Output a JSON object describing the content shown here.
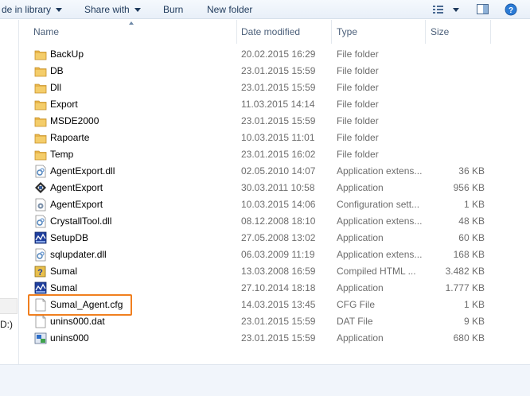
{
  "toolbar": {
    "include_in_library": "de in library",
    "share_with": "Share with",
    "burn": "Burn",
    "new_folder": "New folder"
  },
  "nav": {
    "drive_label": "D:)"
  },
  "columns": {
    "name": "Name",
    "date_modified": "Date modified",
    "type": "Type",
    "size": "Size"
  },
  "files": [
    {
      "name": "BackUp",
      "date": "20.02.2015 16:29",
      "type": "File folder",
      "size": "",
      "icon": "folder-icon"
    },
    {
      "name": "DB",
      "date": "23.01.2015 15:59",
      "type": "File folder",
      "size": "",
      "icon": "folder-icon"
    },
    {
      "name": "Dll",
      "date": "23.01.2015 15:59",
      "type": "File folder",
      "size": "",
      "icon": "folder-icon"
    },
    {
      "name": "Export",
      "date": "11.03.2015 14:14",
      "type": "File folder",
      "size": "",
      "icon": "folder-icon"
    },
    {
      "name": "MSDE2000",
      "date": "23.01.2015 15:59",
      "type": "File folder",
      "size": "",
      "icon": "folder-icon"
    },
    {
      "name": "Rapoarte",
      "date": "10.03.2015 11:01",
      "type": "File folder",
      "size": "",
      "icon": "folder-icon"
    },
    {
      "name": "Temp",
      "date": "23.01.2015 16:02",
      "type": "File folder",
      "size": "",
      "icon": "folder-icon"
    },
    {
      "name": "AgentExport.dll",
      "date": "02.05.2010 14:07",
      "type": "Application extens...",
      "size": "36 KB",
      "icon": "dll-icon"
    },
    {
      "name": "AgentExport",
      "date": "30.03.2011 10:58",
      "type": "Application",
      "size": "956 KB",
      "icon": "application-icon"
    },
    {
      "name": "AgentExport",
      "date": "10.03.2015 14:06",
      "type": "Configuration sett...",
      "size": "1 KB",
      "icon": "config-icon"
    },
    {
      "name": "CrystallTool.dll",
      "date": "08.12.2008 18:10",
      "type": "Application extens...",
      "size": "48 KB",
      "icon": "dll-icon"
    },
    {
      "name": "SetupDB",
      "date": "27.05.2008 13:02",
      "type": "Application",
      "size": "60 KB",
      "icon": "setup-icon"
    },
    {
      "name": "sqlupdater.dll",
      "date": "06.03.2009 11:19",
      "type": "Application extens...",
      "size": "168 KB",
      "icon": "dll-icon"
    },
    {
      "name": "Sumal",
      "date": "13.03.2008 16:59",
      "type": "Compiled HTML ...",
      "size": "3.482 KB",
      "icon": "help-icon"
    },
    {
      "name": "Sumal",
      "date": "27.10.2014 18:18",
      "type": "Application",
      "size": "1.777 KB",
      "icon": "setup-icon"
    },
    {
      "name": "Sumal_Agent.cfg",
      "date": "14.03.2015 13:45",
      "type": "CFG File",
      "size": "1 KB",
      "icon": "file-icon"
    },
    {
      "name": "unins000.dat",
      "date": "23.01.2015 15:59",
      "type": "DAT File",
      "size": "9 KB",
      "icon": "file-icon"
    },
    {
      "name": "unins000",
      "date": "23.01.2015 15:59",
      "type": "Application",
      "size": "680 KB",
      "icon": "uninstaller-icon"
    }
  ],
  "colors": {
    "highlight": "#f07f1f",
    "folder": "#e8b54a"
  }
}
